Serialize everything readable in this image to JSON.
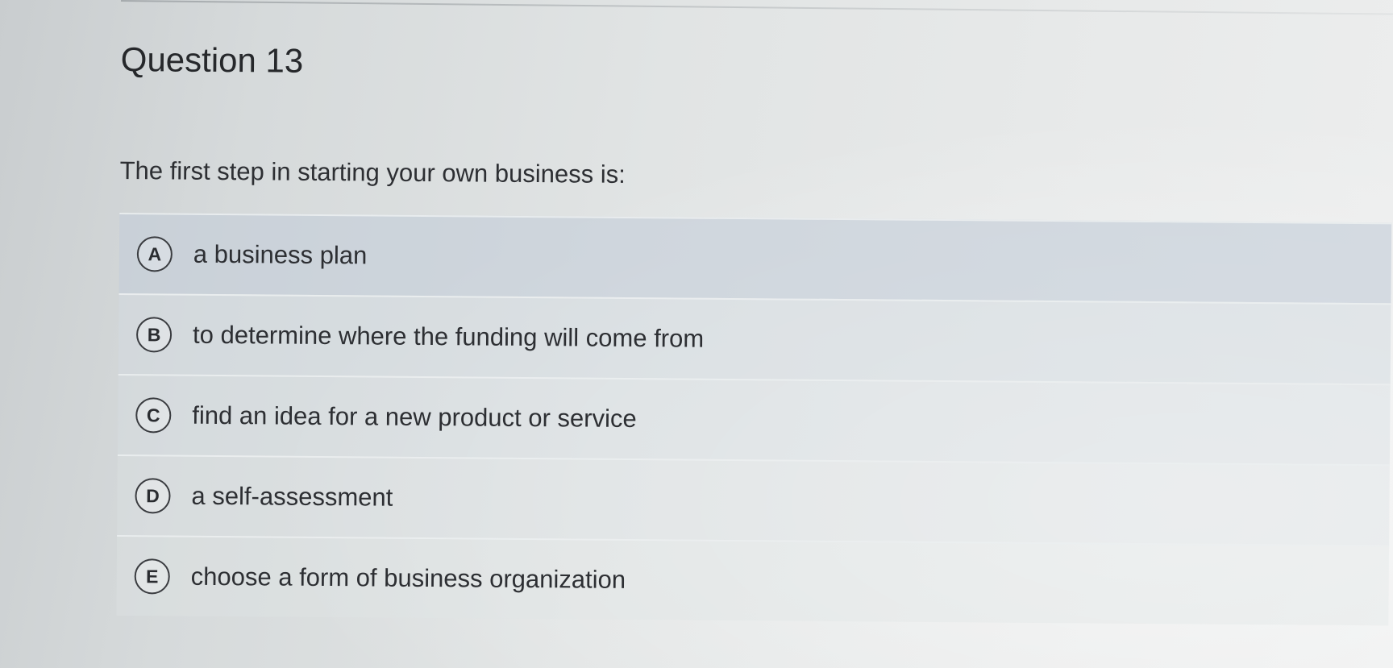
{
  "question": {
    "title": "Question 13",
    "prompt": "The first step in starting your own business is:",
    "options": [
      {
        "letter": "A",
        "text": "a business plan"
      },
      {
        "letter": "B",
        "text": "to determine where the funding will come from"
      },
      {
        "letter": "C",
        "text": "find an idea for a new product or service"
      },
      {
        "letter": "D",
        "text": "a self-assessment"
      },
      {
        "letter": "E",
        "text": "choose a form of business organization"
      }
    ]
  }
}
